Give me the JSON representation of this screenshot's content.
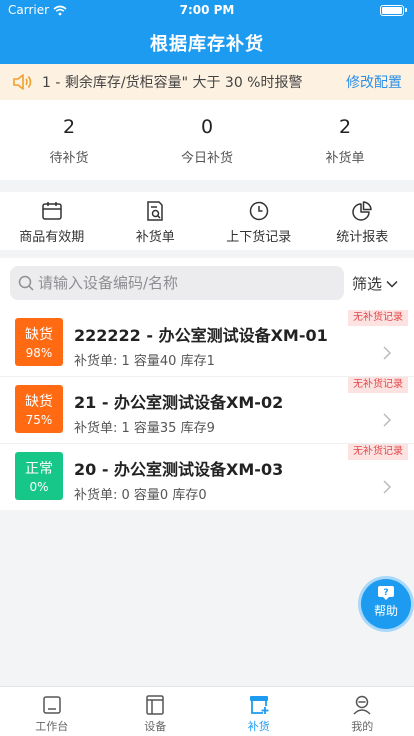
{
  "status_bar": {
    "carrier": "Carrier",
    "time": "7:00 PM"
  },
  "header": {
    "title": "根据库存补货"
  },
  "notice": {
    "text": "1 - 剩余库存/货柜容量\" 大于 30 %时报警",
    "action": "修改配置"
  },
  "stats": [
    {
      "value": "2",
      "label": "待补货"
    },
    {
      "value": "0",
      "label": "今日补货"
    },
    {
      "value": "2",
      "label": "补货单"
    }
  ],
  "menu": [
    {
      "icon": "calendar-icon",
      "label": "商品有效期"
    },
    {
      "icon": "document-search-icon",
      "label": "补货单"
    },
    {
      "icon": "clock-icon",
      "label": "上下货记录"
    },
    {
      "icon": "pie-chart-icon",
      "label": "统计报表"
    }
  ],
  "search": {
    "placeholder": "请输入设备编码/名称",
    "value": ""
  },
  "filter": {
    "label": "筛选"
  },
  "devices": [
    {
      "status": "缺货",
      "percent": "98%",
      "color": "#ff6a13",
      "name": "222222 - 办公室测试设备XM-01",
      "meta": "补货单: 1 容量40 库存1",
      "tag": "无补货记录"
    },
    {
      "status": "缺货",
      "percent": "75%",
      "color": "#ff6a13",
      "name": "21 - 办公室测试设备XM-02",
      "meta": "补货单: 1 容量35 库存9",
      "tag": "无补货记录"
    },
    {
      "status": "正常",
      "percent": "0%",
      "color": "#17c78a",
      "name": "20 - 办公室测试设备XM-03",
      "meta": "补货单: 0 容量0 库存0",
      "tag": "无补货记录"
    }
  ],
  "help": {
    "label": "帮助"
  },
  "tabbar": [
    {
      "icon": "workbench-icon",
      "label": "工作台",
      "active": false
    },
    {
      "icon": "device-icon",
      "label": "设备",
      "active": false
    },
    {
      "icon": "restock-icon",
      "label": "补货",
      "active": true
    },
    {
      "icon": "profile-icon",
      "label": "我的",
      "active": false
    }
  ],
  "colors": {
    "primary": "#1d9bf0",
    "notice_bg": "#fdf1e1",
    "shortage": "#ff6a13",
    "normal": "#17c78a",
    "tag_text": "#e24a4a"
  }
}
